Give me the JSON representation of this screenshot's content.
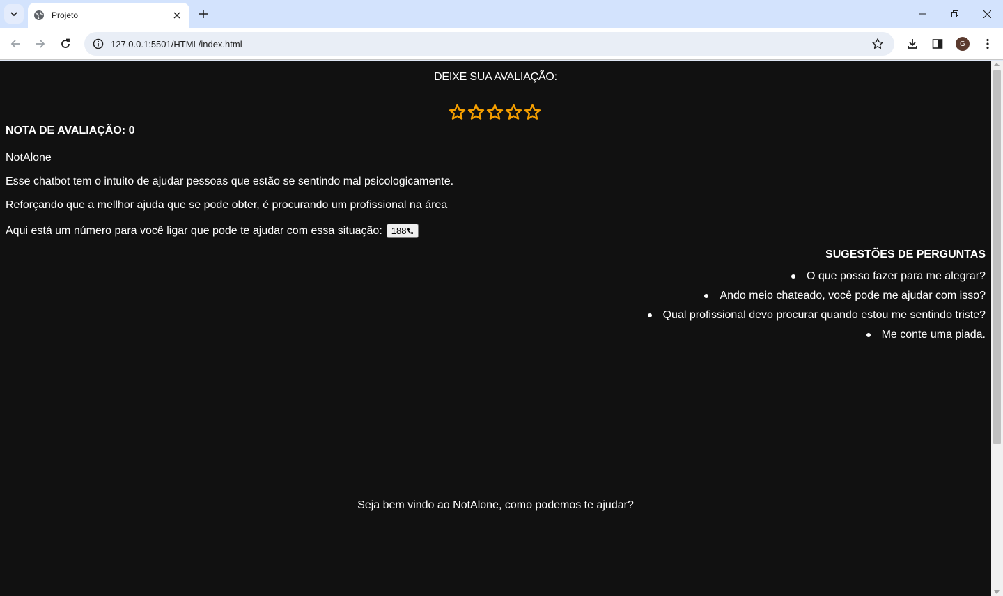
{
  "browser": {
    "tab_title": "Projeto",
    "url": "127.0.0.1:5501/HTML/index.html",
    "profile_initial": "G"
  },
  "page": {
    "rating_title": "DEIXE SUA AVALIAÇÃO:",
    "stars": {
      "count": 5,
      "filled": 0,
      "color": "#f59f00"
    },
    "rating_score": "NOTA DE AVALIAÇÃO: 0",
    "app_name": "NotAlone",
    "description": "Esse chatbot tem o intuito de ajudar pessoas que estão se sentindo mal psicologicamente.",
    "reinforcement": "Reforçando que a mellhor ajuda que se pode obter, é procurando um profissional na área",
    "phone_text": "Aqui está um número para você ligar que pode te ajudar com essa situação:",
    "phone_button_label": "188",
    "suggestions_title": "SUGESTÕES DE PERGUNTAS",
    "suggestions": [
      "O que posso fazer para me alegrar?",
      "Ando meio chateado, você pode me ajudar com isso?",
      "Qual profissional devo procurar quando estou me sentindo triste?",
      "Me conte uma piada."
    ],
    "welcome_message": "Seja bem vindo ao NotAlone, como podemos te ajudar?"
  }
}
